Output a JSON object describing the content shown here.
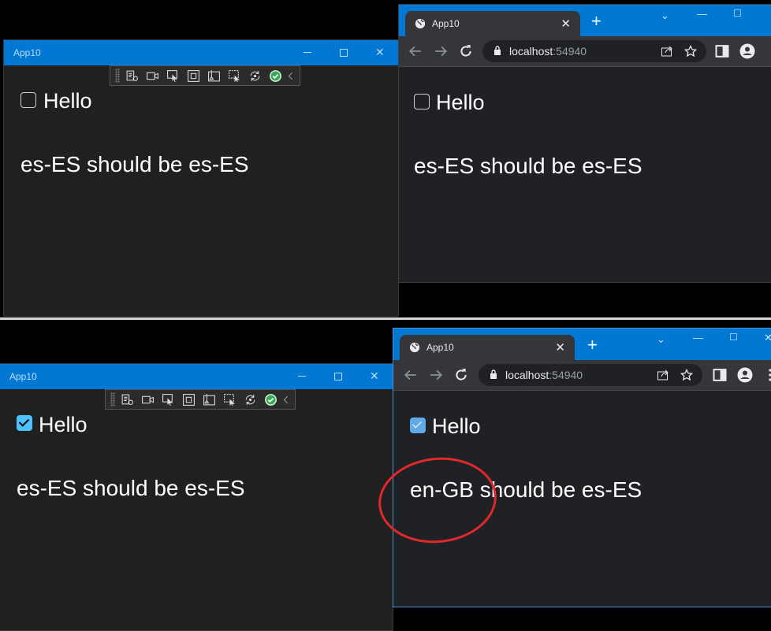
{
  "panels": {
    "top_app": {
      "title": "App10",
      "checkbox_label": "Hello",
      "checked": false,
      "message": "es-ES should be es-ES"
    },
    "top_browser": {
      "tab_title": "App10",
      "url_host": "localhost",
      "url_port": ":54940",
      "checkbox_label": "Hello",
      "checked": false,
      "message": "es-ES should be es-ES"
    },
    "bottom_app": {
      "title": "App10",
      "checkbox_label": "Hello",
      "checked": true,
      "message": "es-ES should be es-ES"
    },
    "bottom_browser": {
      "tab_title": "App10",
      "url_host": "localhost",
      "url_port": ":54940",
      "checkbox_label": "Hello",
      "checked": true,
      "message": "en-GB should be es-ES"
    }
  },
  "icons": {
    "toolbar": [
      "live-visual-tree-icon",
      "record-icon",
      "select-element-icon",
      "display-layout-adorners-icon",
      "track-focus-icon",
      "preview-selection-icon",
      "hot-reload-icon",
      "status-ok-icon",
      "collapse-chevron-icon"
    ],
    "browser": [
      "back-icon",
      "forward-icon",
      "reload-icon",
      "lock-icon",
      "share-icon",
      "bookmark-star-icon",
      "side-panel-icon",
      "profile-icon",
      "menu-icon"
    ]
  },
  "colors": {
    "titlebar": "#0078d4",
    "window_bg": "#202020",
    "checkbox_checked": "#4cc2ff",
    "annotation_circle": "#e0282d"
  }
}
